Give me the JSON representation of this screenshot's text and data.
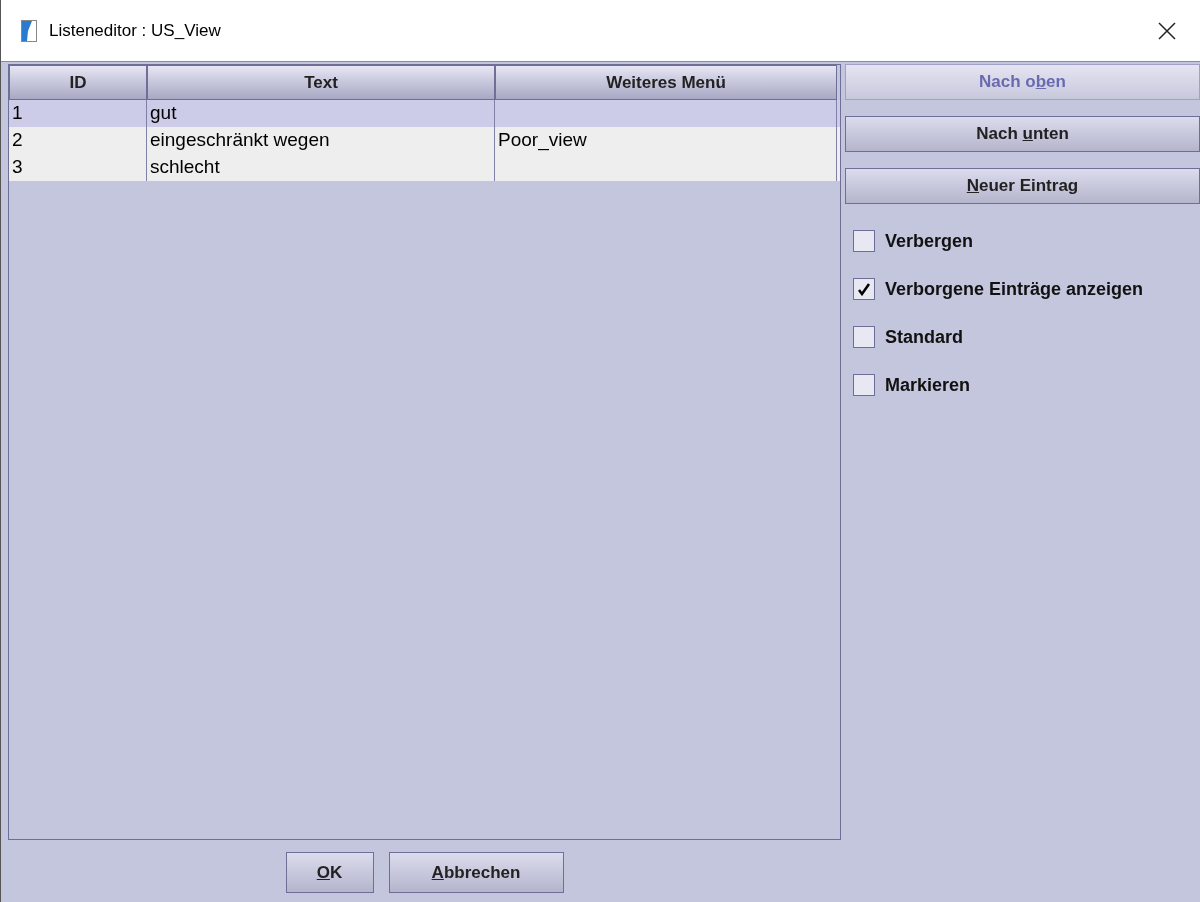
{
  "window": {
    "title": "Listeneditor : US_View"
  },
  "table": {
    "columns": [
      "ID",
      "Text",
      "Weiteres Menü"
    ],
    "rows": [
      {
        "cells": [
          "1",
          "gut",
          ""
        ],
        "selected": true
      },
      {
        "cells": [
          "2",
          "eingeschränkt wegen",
          "Poor_view"
        ],
        "selected": false
      },
      {
        "cells": [
          "3",
          "schlecht",
          ""
        ],
        "selected": false
      }
    ]
  },
  "side_buttons": [
    {
      "label": {
        "before": "Nach o",
        "key": "b",
        "after": "en"
      },
      "disabled": true
    },
    {
      "label": {
        "before": "Nach ",
        "key": "u",
        "after": "nten"
      },
      "disabled": false
    },
    {
      "label": {
        "key": "N",
        "after": "euer Eintrag"
      },
      "disabled": false
    }
  ],
  "checkboxes": [
    {
      "label": "Verbergen",
      "checked": false
    },
    {
      "label": "Verborgene Einträge anzeigen",
      "checked": true
    },
    {
      "label": "Standard",
      "checked": false
    },
    {
      "label": "Markieren",
      "checked": false
    }
  ],
  "footer_buttons": [
    {
      "label": {
        "key": "O",
        "after": "K"
      }
    },
    {
      "label": {
        "key": "A",
        "after": "bbrechen"
      }
    }
  ]
}
